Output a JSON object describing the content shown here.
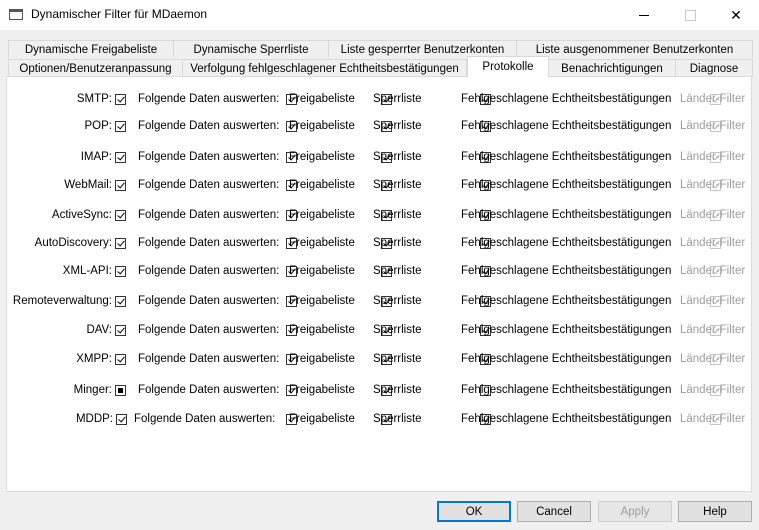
{
  "window": {
    "title": "Dynamischer Filter für MDaemon",
    "minimize_glyph": "—",
    "close_glyph": "✕"
  },
  "tabs_row1": [
    {
      "label": "Dynamische Freigabeliste"
    },
    {
      "label": "Dynamische Sperrliste"
    },
    {
      "label": "Liste gesperrter Benutzerkonten"
    },
    {
      "label": "Liste ausgenommener Benutzerkonten"
    }
  ],
  "tabs_row2": [
    {
      "label": "Optionen/Benutzeranpassung"
    },
    {
      "label": "Verfolgung fehlgeschlagener Echtheitsbestätigungen"
    },
    {
      "label": "Protokolle",
      "active": true
    },
    {
      "label": "Benachrichtigungen"
    },
    {
      "label": "Diagnose"
    }
  ],
  "common": {
    "evaluate_label": "Folgende Daten auswerten:",
    "allowlist_label": "Freigabeliste",
    "blocklist_label": "Sperrliste",
    "failed_auth_label": "Fehlgeschlagene Echtheitsbestätigungen",
    "country_filter_label": "Länder-Filter"
  },
  "protocols": [
    {
      "name": "SMTP:",
      "enabled": "checked",
      "allow": true,
      "block": true,
      "failed": true,
      "country": true
    },
    {
      "name": "POP:",
      "enabled": "checked",
      "allow": true,
      "block": true,
      "failed": true,
      "country": true
    },
    {
      "name": "IMAP:",
      "enabled": "checked",
      "allow": true,
      "block": true,
      "failed": true,
      "country": true
    },
    {
      "name": "WebMail:",
      "enabled": "checked",
      "allow": true,
      "block": true,
      "failed": true,
      "country": true
    },
    {
      "name": "ActiveSync:",
      "enabled": "checked",
      "allow": true,
      "block": true,
      "failed": true,
      "country": true
    },
    {
      "name": "AutoDiscovery:",
      "enabled": "checked",
      "allow": true,
      "block": true,
      "failed": true,
      "country": true
    },
    {
      "name": "XML-API:",
      "enabled": "checked",
      "allow": true,
      "block": true,
      "failed": true,
      "country": true
    },
    {
      "name": "Remoteverwaltung:",
      "enabled": "checked",
      "allow": true,
      "block": true,
      "failed": true,
      "country": true
    },
    {
      "name": "DAV:",
      "enabled": "checked",
      "allow": true,
      "block": true,
      "failed": true,
      "country": true
    },
    {
      "name": "XMPP:",
      "enabled": "checked",
      "allow": true,
      "block": true,
      "failed": true,
      "country": true
    },
    {
      "name": "Minger:",
      "enabled": "indeterminate",
      "allow": true,
      "block": true,
      "failed": false,
      "country": true
    },
    {
      "name": "MDDP:",
      "enabled": "checked",
      "allow": true,
      "block": true,
      "failed": true,
      "country": true
    }
  ],
  "buttons": {
    "ok": "OK",
    "cancel": "Cancel",
    "apply": "Apply",
    "help": "Help"
  }
}
